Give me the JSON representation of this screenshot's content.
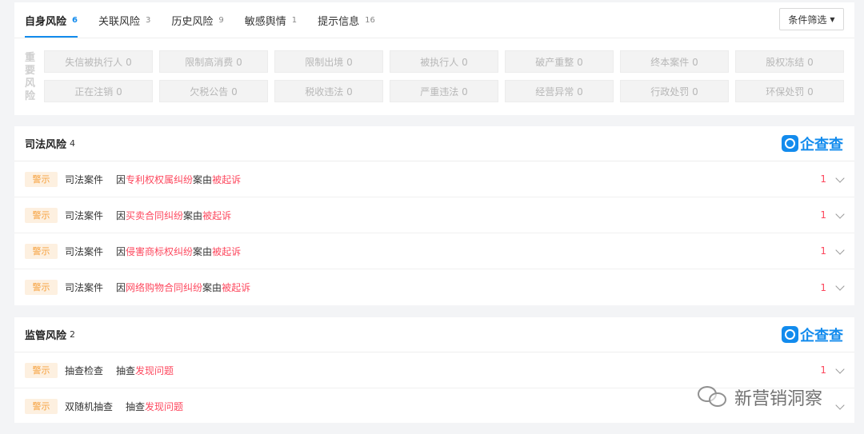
{
  "tabs": [
    {
      "label": "自身风险",
      "count": "6"
    },
    {
      "label": "关联风险",
      "count": "3"
    },
    {
      "label": "历史风险",
      "count": "9"
    },
    {
      "label": "敏感舆情",
      "count": "1"
    },
    {
      "label": "提示信息",
      "count": "16"
    }
  ],
  "filter": {
    "label": "条件筛选"
  },
  "overview": {
    "side_label": "重要风险",
    "cells": [
      "失信被执行人 0",
      "限制高消费 0",
      "限制出境 0",
      "被执行人 0",
      "破产重整 0",
      "终本案件 0",
      "股权冻结 0",
      "正在注销 0",
      "欠税公告 0",
      "税收违法 0",
      "严重违法 0",
      "经营异常 0",
      "行政处罚 0",
      "环保处罚 0"
    ]
  },
  "judicial": {
    "title": "司法风险",
    "count": "4",
    "logo": "企查查",
    "rows": [
      {
        "tag": "警示",
        "type": "司法案件",
        "pre": "因",
        "reason": "专利权权属纠纷",
        "mid": "案由",
        "action": "被起诉",
        "count": "1"
      },
      {
        "tag": "警示",
        "type": "司法案件",
        "pre": "因",
        "reason": "买卖合同纠纷",
        "mid": "案由",
        "action": "被起诉",
        "count": "1"
      },
      {
        "tag": "警示",
        "type": "司法案件",
        "pre": "因",
        "reason": "侵害商标权纠纷",
        "mid": "案由",
        "action": "被起诉",
        "count": "1"
      },
      {
        "tag": "警示",
        "type": "司法案件",
        "pre": "因",
        "reason": "网络购物合同纠纷",
        "mid": "案由",
        "action": "被起诉",
        "count": "1"
      }
    ]
  },
  "regulatory": {
    "title": "监管风险",
    "count": "2",
    "logo": "企查查",
    "rows": [
      {
        "tag": "警示",
        "type": "抽查检查",
        "pre": "抽查",
        "reason": "发现问题",
        "count": "1"
      },
      {
        "tag": "警示",
        "type": "双随机抽查",
        "pre": "抽查",
        "reason": "发现问题",
        "count": ""
      }
    ]
  },
  "watermark": {
    "text": "新营销洞察",
    "icon": "wechat-icon"
  },
  "colors": {
    "accent": "#128bed",
    "danger": "#fd485e",
    "tag_bg": "#fdf0e0",
    "tag_text": "#f6a03c"
  }
}
